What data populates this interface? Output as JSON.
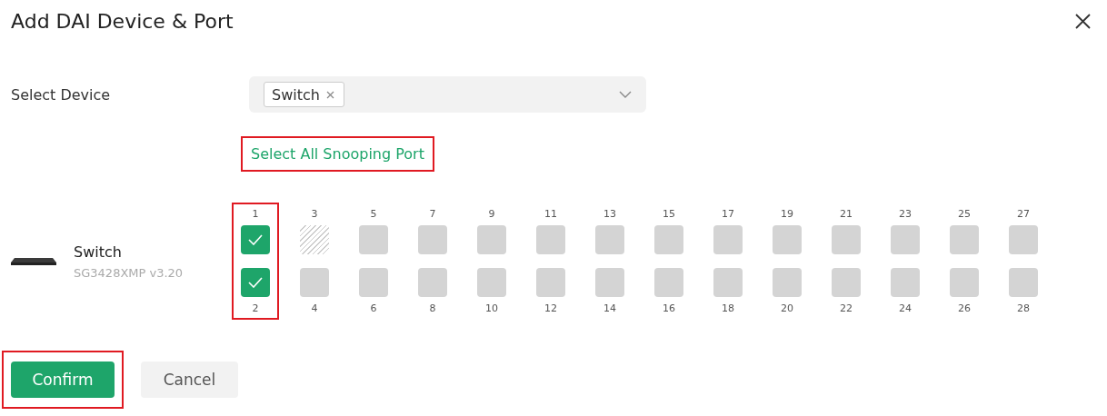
{
  "dialog": {
    "title": "Add DAI Device & Port"
  },
  "device_select": {
    "label": "Select Device",
    "tags": [
      "Switch"
    ]
  },
  "select_all_link": {
    "label": "Select All Snooping Port",
    "highlighted": true
  },
  "device": {
    "name": "Switch",
    "model": "SG3428XMP v3.20"
  },
  "port_columns": [
    {
      "highlighted": true,
      "ports": [
        {
          "label": "1",
          "checked": true,
          "disabled": false
        },
        {
          "label": "2",
          "checked": true,
          "disabled": false
        }
      ]
    },
    {
      "highlighted": false,
      "ports": [
        {
          "label": "3",
          "checked": false,
          "disabled": true
        },
        {
          "label": "4",
          "checked": false,
          "disabled": false
        }
      ]
    },
    {
      "highlighted": false,
      "ports": [
        {
          "label": "5",
          "checked": false,
          "disabled": false
        },
        {
          "label": "6",
          "checked": false,
          "disabled": false
        }
      ]
    },
    {
      "highlighted": false,
      "ports": [
        {
          "label": "7",
          "checked": false,
          "disabled": false
        },
        {
          "label": "8",
          "checked": false,
          "disabled": false
        }
      ]
    },
    {
      "highlighted": false,
      "ports": [
        {
          "label": "9",
          "checked": false,
          "disabled": false
        },
        {
          "label": "10",
          "checked": false,
          "disabled": false
        }
      ]
    },
    {
      "highlighted": false,
      "ports": [
        {
          "label": "11",
          "checked": false,
          "disabled": false
        },
        {
          "label": "12",
          "checked": false,
          "disabled": false
        }
      ]
    },
    {
      "highlighted": false,
      "ports": [
        {
          "label": "13",
          "checked": false,
          "disabled": false
        },
        {
          "label": "14",
          "checked": false,
          "disabled": false
        }
      ]
    },
    {
      "highlighted": false,
      "ports": [
        {
          "label": "15",
          "checked": false,
          "disabled": false
        },
        {
          "label": "16",
          "checked": false,
          "disabled": false
        }
      ]
    },
    {
      "highlighted": false,
      "ports": [
        {
          "label": "17",
          "checked": false,
          "disabled": false
        },
        {
          "label": "18",
          "checked": false,
          "disabled": false
        }
      ]
    },
    {
      "highlighted": false,
      "ports": [
        {
          "label": "19",
          "checked": false,
          "disabled": false
        },
        {
          "label": "20",
          "checked": false,
          "disabled": false
        }
      ]
    },
    {
      "highlighted": false,
      "ports": [
        {
          "label": "21",
          "checked": false,
          "disabled": false
        },
        {
          "label": "22",
          "checked": false,
          "disabled": false
        }
      ]
    },
    {
      "highlighted": false,
      "ports": [
        {
          "label": "23",
          "checked": false,
          "disabled": false
        },
        {
          "label": "24",
          "checked": false,
          "disabled": false
        }
      ]
    },
    {
      "highlighted": false,
      "ports": [
        {
          "label": "25",
          "checked": false,
          "disabled": false
        },
        {
          "label": "26",
          "checked": false,
          "disabled": false
        }
      ]
    },
    {
      "highlighted": false,
      "ports": [
        {
          "label": "27",
          "checked": false,
          "disabled": false
        },
        {
          "label": "28",
          "checked": false,
          "disabled": false
        }
      ]
    }
  ],
  "buttons": [
    {
      "kind": "primary",
      "label": "Confirm",
      "highlighted": true
    },
    {
      "kind": "secondary",
      "label": "Cancel",
      "highlighted": false
    }
  ]
}
